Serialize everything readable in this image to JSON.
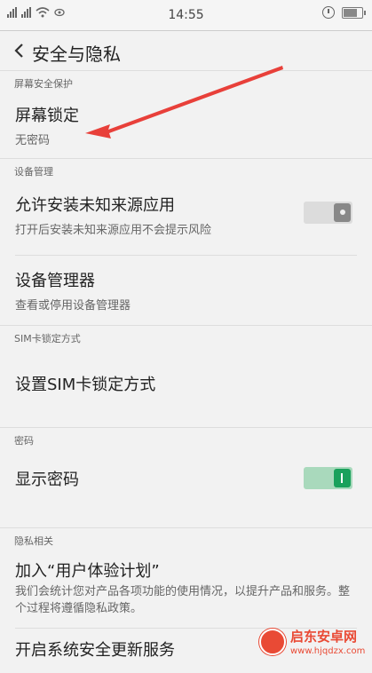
{
  "status_bar": {
    "time": "14:55"
  },
  "header": {
    "title": "安全与隐私"
  },
  "sections": {
    "screen_protect": {
      "header": "屏幕安全保护",
      "screen_lock": {
        "title": "屏幕锁定",
        "subtitle": "无密码"
      }
    },
    "device_mgmt": {
      "header": "设备管理",
      "unknown_sources": {
        "title": "允许安装未知来源应用",
        "subtitle": "打开后安装未知来源应用不会提示风险",
        "enabled": false
      },
      "device_admin": {
        "title": "设备管理器",
        "subtitle": "查看或停用设备管理器"
      }
    },
    "sim_lock": {
      "header": "SIM卡锁定方式",
      "set_sim": {
        "title": "设置SIM卡锁定方式"
      }
    },
    "password": {
      "header": "密码",
      "show_password": {
        "title": "显示密码",
        "enabled": true
      }
    },
    "privacy": {
      "header": "隐私相关",
      "ux_plan": {
        "title": "加入“用户体验计划”",
        "subtitle": "我们会统计您对产品各项功能的使用情况，以提升产品和服务。整个过程将遵循隐私政策。"
      },
      "security_update": {
        "title": "开启系统安全更新服务"
      }
    }
  },
  "watermark": {
    "name": "启东安卓网",
    "url": "www.hjqdzx.com"
  },
  "colors": {
    "toggle_on": "#1aa15c",
    "arrow": "#e8403a"
  }
}
